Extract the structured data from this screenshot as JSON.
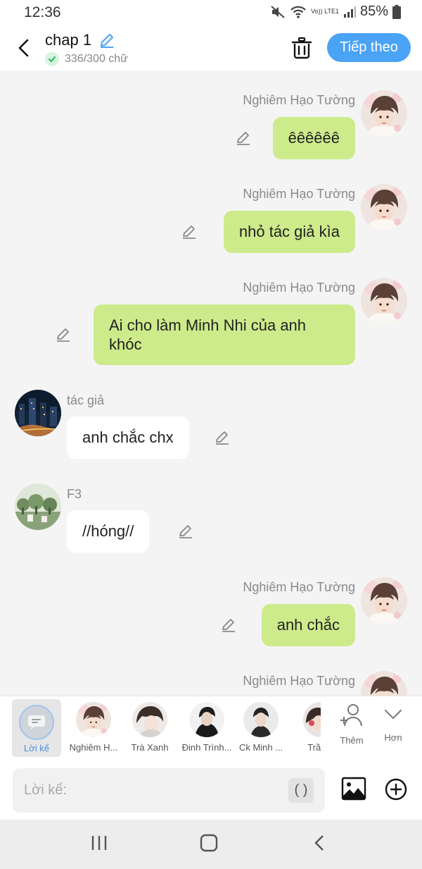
{
  "status": {
    "time": "12:36",
    "battery": "85%",
    "network": "Vo)) LTE1"
  },
  "header": {
    "title": "chap 1",
    "word_count": "336/300 chữ",
    "next_label": "Tiếp theo"
  },
  "messages": [
    {
      "side": "right",
      "name": "Nghiêm Hạo Tường",
      "text": "êêêêêê",
      "avatar": "avatar-tuong"
    },
    {
      "side": "right",
      "name": "Nghiêm Hạo Tường",
      "text": "nhỏ tác giả kìa",
      "avatar": "avatar-tuong"
    },
    {
      "side": "right",
      "name": "Nghiêm Hạo Tường",
      "text": "Ai cho làm Minh Nhi của anh khóc",
      "avatar": "avatar-tuong"
    },
    {
      "side": "left",
      "name": "tác giả",
      "text": "anh chắc chx",
      "avatar": "avatar-city-night"
    },
    {
      "side": "left",
      "name": "F3",
      "text": "//hóng//",
      "avatar": "avatar-garden"
    },
    {
      "side": "right",
      "name": "Nghiêm Hạo Tường",
      "text": "anh chắc",
      "avatar": "avatar-tuong"
    },
    {
      "side": "right",
      "name": "Nghiêm Hạo Tường",
      "text": "",
      "avatar": "avatar-tuong"
    }
  ],
  "characters": {
    "narrator_label": "Lời kể",
    "items": [
      {
        "label": "Nghiêm H..."
      },
      {
        "label": "Trà Xanh"
      },
      {
        "label": "Đinh Trình..."
      },
      {
        "label": "Ck Minh ..."
      },
      {
        "label": "Trần T"
      }
    ],
    "add_label": "Thêm",
    "more_label": "Hơn"
  },
  "input": {
    "placeholder": "Lời kể:",
    "value": "",
    "paren_label": "( )"
  },
  "colors": {
    "accent": "#4aa3f5",
    "my_bubble": "#cdeb8b",
    "other_bubble": "#ffffff",
    "background": "#f4f4f4"
  }
}
